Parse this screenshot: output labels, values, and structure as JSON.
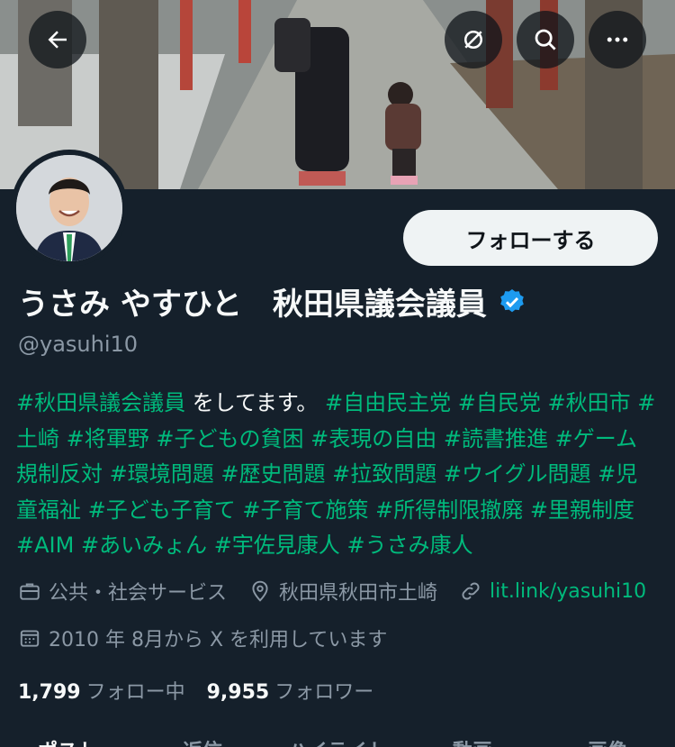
{
  "nav": {
    "back_icon": "arrow-left-icon",
    "grok_icon": "grok-icon",
    "search_icon": "search-icon",
    "more_icon": "more-dots-icon"
  },
  "profile": {
    "name": "うさみ やすひと　秋田県議会議員",
    "handle": "@yasuhi10",
    "verified": true,
    "follow_label": "フォローする",
    "bio_segments": [
      {
        "text": "#秋田県議会議員",
        "tag": true
      },
      {
        "text": " をしてます。 ",
        "tag": false
      },
      {
        "text": "#自由民主党",
        "tag": true
      },
      {
        "text": " ",
        "tag": false
      },
      {
        "text": "#自民党",
        "tag": true
      },
      {
        "text": " ",
        "tag": false
      },
      {
        "text": "#秋田市",
        "tag": true
      },
      {
        "text": " ",
        "tag": false
      },
      {
        "text": "#土崎",
        "tag": true
      },
      {
        "text": " ",
        "tag": false
      },
      {
        "text": "#将軍野",
        "tag": true
      },
      {
        "text": " ",
        "tag": false
      },
      {
        "text": "#子どもの貧困",
        "tag": true
      },
      {
        "text": " ",
        "tag": false
      },
      {
        "text": "#表現の自由",
        "tag": true
      },
      {
        "text": " ",
        "tag": false
      },
      {
        "text": "#読書推進",
        "tag": true
      },
      {
        "text": " ",
        "tag": false
      },
      {
        "text": "#ゲーム規制反対",
        "tag": true
      },
      {
        "text": " ",
        "tag": false
      },
      {
        "text": "#環境問題",
        "tag": true
      },
      {
        "text": " ",
        "tag": false
      },
      {
        "text": "#歴史問題",
        "tag": true
      },
      {
        "text": " ",
        "tag": false
      },
      {
        "text": "#拉致問題",
        "tag": true
      },
      {
        "text": " ",
        "tag": false
      },
      {
        "text": "#ウイグル問題",
        "tag": true
      },
      {
        "text": " ",
        "tag": false
      },
      {
        "text": "#児童福祉",
        "tag": true
      },
      {
        "text": " ",
        "tag": false
      },
      {
        "text": "#子ども子育て",
        "tag": true
      },
      {
        "text": " ",
        "tag": false
      },
      {
        "text": "#子育て施策",
        "tag": true
      },
      {
        "text": " ",
        "tag": false
      },
      {
        "text": "#所得制限撤廃",
        "tag": true
      },
      {
        "text": " ",
        "tag": false
      },
      {
        "text": "#里親制度",
        "tag": true
      },
      {
        "text": " ",
        "tag": false
      },
      {
        "text": "#AIM",
        "tag": true
      },
      {
        "text": " ",
        "tag": false
      },
      {
        "text": "#あいみょん",
        "tag": true
      },
      {
        "text": " ",
        "tag": false
      },
      {
        "text": "#宇佐見康人",
        "tag": true
      },
      {
        "text": " ",
        "tag": false
      },
      {
        "text": "#うさみ康人",
        "tag": true
      }
    ],
    "category": "公共・社会サービス",
    "location": "秋田県秋田市土崎",
    "link": "lit.link/yasuhi10",
    "joined": "2010 年 8月から X を利用しています",
    "following_count": "1,799",
    "following_label": "フォロー中",
    "followers_count": "9,955",
    "followers_label": "フォロワー"
  },
  "tabs": [
    "ポスト",
    "返信",
    "ハイライト",
    "動画",
    "画像"
  ],
  "colors": {
    "background": "#15202b",
    "accent_green": "#00ba7c",
    "muted": "#8b98a5",
    "verified_blue": "#1d9bf0"
  }
}
